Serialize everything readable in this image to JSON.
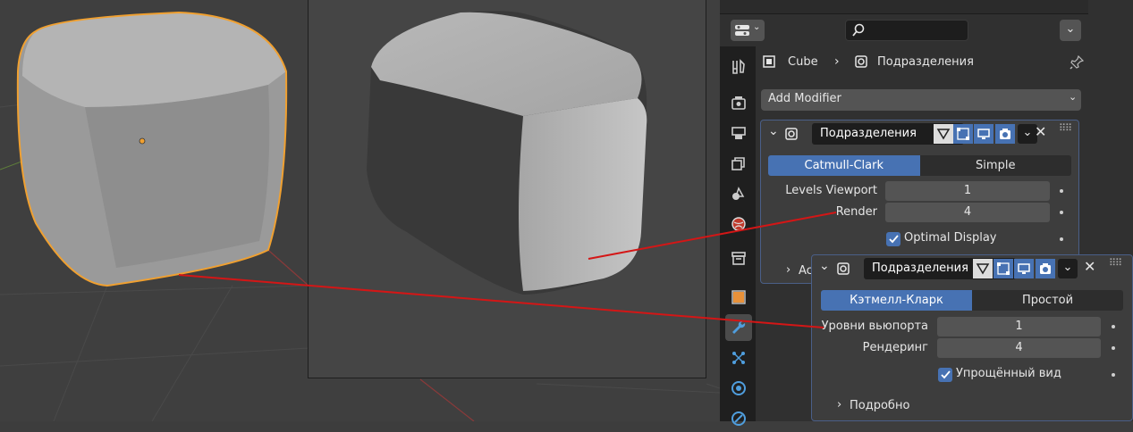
{
  "header": {
    "search_placeholder": ""
  },
  "breadcrumb": {
    "object": "Cube",
    "modifier": "Подразделения"
  },
  "add_modifier_label": "Add Modifier",
  "modifier_en": {
    "name": "Подразделения",
    "type_catmull": "Catmull-Clark",
    "type_simple": "Simple",
    "levels_viewport_label": "Levels Viewport",
    "levels_viewport_value": "1",
    "render_label": "Render",
    "render_value": "4",
    "optimal_display_label": "Optimal Display",
    "advanced_label": "Ac"
  },
  "modifier_ru": {
    "name": "Подразделения",
    "type_catmull": "Кэтмелл-Кларк",
    "type_simple": "Простой",
    "levels_viewport_label": "Уровни вьюпорта",
    "levels_viewport_value": "1",
    "render_label": "Рендеринг",
    "render_value": "4",
    "optimal_display_label": "Упрощённый вид",
    "advanced_label": "Подробно"
  },
  "colors": {
    "accent": "#4772b3",
    "selection_outline": "#f0a030",
    "annotation_line": "#d41616"
  },
  "tabs": [
    "tool-icon",
    "render-icon",
    "output-icon",
    "view-layer-icon",
    "scene-icon",
    "world-icon",
    "collection-icon",
    "object-icon",
    "modifier-icon",
    "particles-icon",
    "physics-icon",
    "constraints-icon"
  ]
}
